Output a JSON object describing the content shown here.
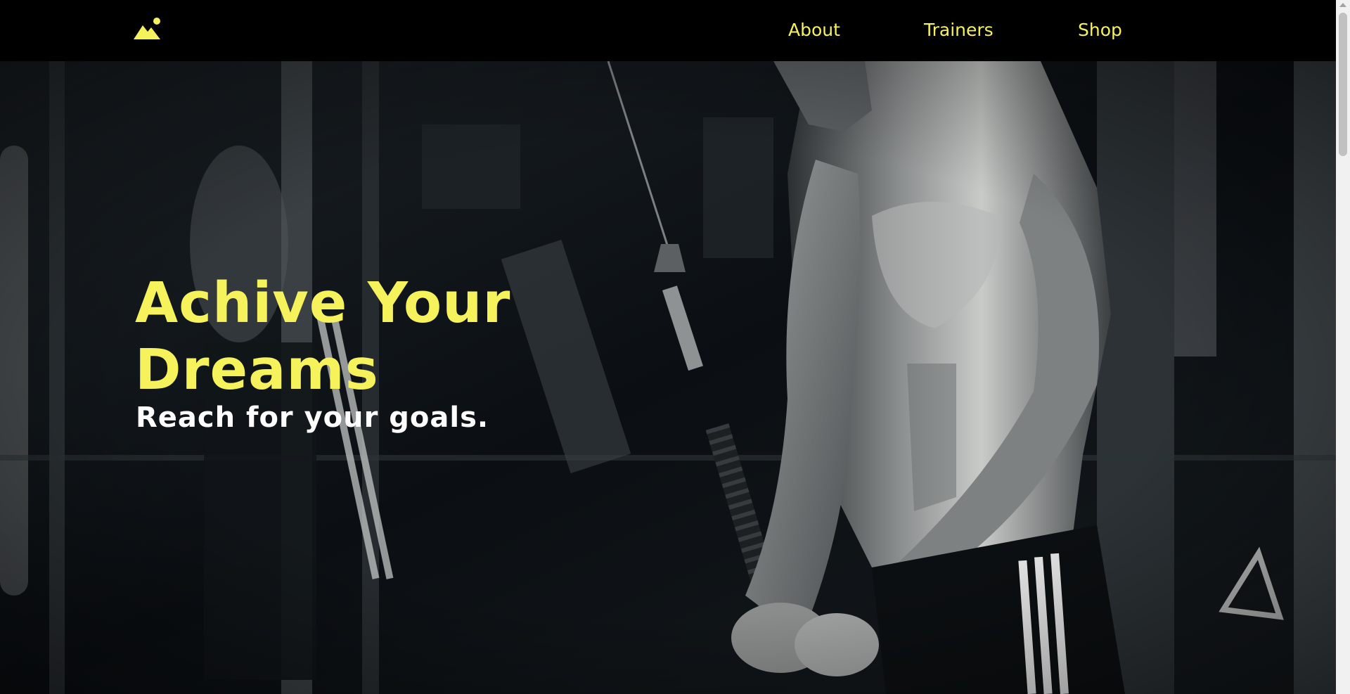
{
  "navbar": {
    "logo_icon": "mountain-sun-logo-icon",
    "links": [
      {
        "label": "About"
      },
      {
        "label": "Trainers"
      },
      {
        "label": "Shop"
      }
    ]
  },
  "hero": {
    "title": "Achive Your Dreams",
    "subtitle": "Reach for your goals.",
    "background_image": "black-and-white gym photo of a muscular man doing cable rope pushdowns"
  },
  "colors": {
    "accent": "#f5f25c",
    "nav_background": "#000000",
    "subtitle": "#ffffff"
  }
}
